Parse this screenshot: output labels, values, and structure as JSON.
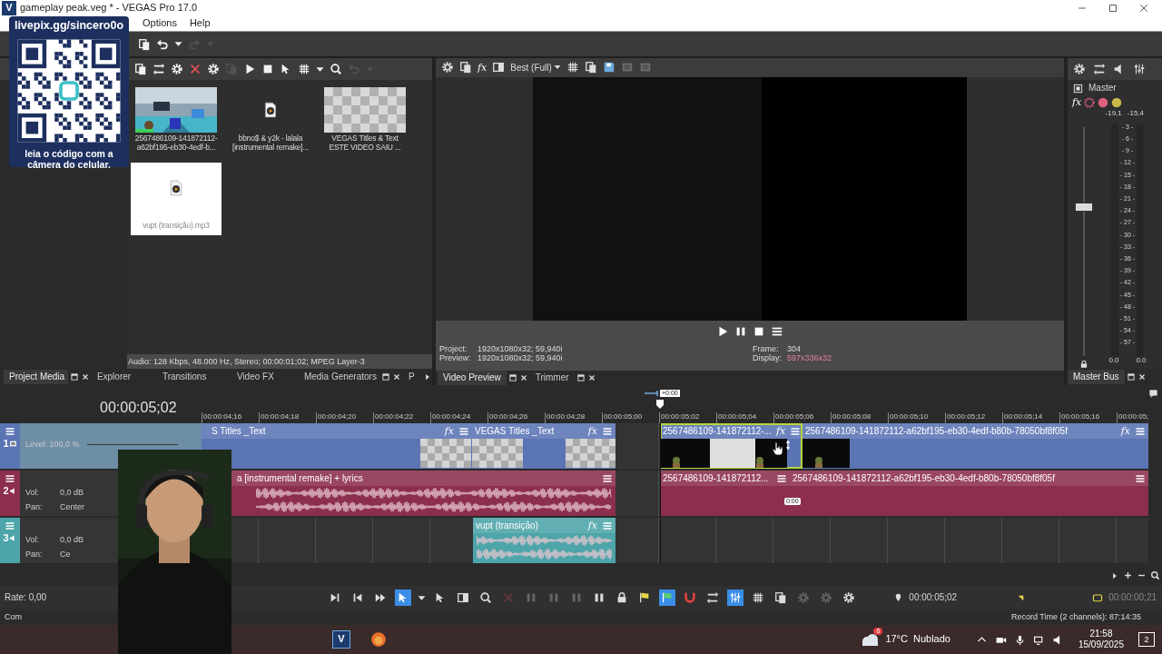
{
  "title_bar": {
    "app_letter": "V",
    "title": "gameplay peak.veg * - VEGAS Pro 17.0"
  },
  "menu": [
    "Options",
    "Help"
  ],
  "stream_overlay": {
    "url": "livepix.gg/sincero0o",
    "caption": "leia o código com a câmera do celular."
  },
  "main_toolbar": [
    {
      "disabled": false
    },
    {
      "disabled": false
    },
    {
      "disabled": false
    },
    {
      "disabled": true
    },
    {
      "disabled": true
    }
  ],
  "media_toolbar": [
    {
      "disabled": false
    },
    {
      "disabled": false
    },
    {
      "disabled": false
    },
    {
      "disabled": false
    },
    {
      "disabled": false
    },
    {
      "disabled": true
    },
    {
      "disabled": false
    },
    {
      "disabled": false
    },
    {
      "disabled": false
    },
    {
      "disabled": false
    },
    {
      "disabled": false
    },
    {
      "disabled": false
    },
    {
      "disabled": true
    },
    {
      "disabled": true
    }
  ],
  "project_media": {
    "items": [
      {
        "kind": "video",
        "lines": [
          "2567486109-141872112-",
          "a62bf195-eb30-4edf-b..."
        ],
        "selected": false
      },
      {
        "kind": "audio",
        "lines": [
          "bbno$ & y2k - lalala",
          "[instrumental remake]..."
        ],
        "selected": false
      },
      {
        "kind": "title",
        "lines": [
          "VEGAS Titles & Text",
          "ESTE VIDEO SAIU ..."
        ],
        "selected": false
      },
      {
        "kind": "audio",
        "lines": [
          "vupt (transição).mp3"
        ],
        "selected": true
      }
    ],
    "info": "Audio: 128 Kbps, 48.000 Hz, Stereo; 00:00:01;02; MPEG Layer-3"
  },
  "left_tabs": [
    {
      "label": "Project Media",
      "selected": true,
      "closable": true
    },
    {
      "label": "Explorer",
      "selected": false,
      "closable": false
    },
    {
      "label": "Transitions",
      "selected": false,
      "closable": false
    },
    {
      "label": "Video FX",
      "selected": false,
      "closable": false
    },
    {
      "label": "Media Generators",
      "selected": false,
      "closable": true
    },
    {
      "label": "P",
      "selected": false,
      "closable": false
    }
  ],
  "preview": {
    "fx": "fx",
    "quality": "Best (Full)",
    "project_label": "Project:",
    "project": "1920x1080x32; 59,940i",
    "preview_label": "Preview:",
    "preview": "1920x1080x32; 59,940i",
    "frame_label": "Frame:",
    "frame": "304",
    "display_label": "Display:",
    "display": "597x336x32"
  },
  "preview_toolbar": [
    {
      "disabled": false
    },
    {
      "disabled": false
    },
    {
      "disabled": false
    },
    {
      "disabled": false
    },
    {
      "disabled": false
    },
    {
      "disabled": false
    },
    {
      "disabled": true
    },
    {
      "disabled": true
    }
  ],
  "preview_tabs": [
    {
      "label": "Video Preview",
      "selected": true
    },
    {
      "label": "Trimmer",
      "selected": false
    }
  ],
  "master": {
    "title": "Master",
    "fx": "fx",
    "peaks": [
      "-19,1",
      "-15,4"
    ],
    "scale": [
      "- 3 -",
      "- 6 -",
      "- 9 -",
      "- 12 -",
      "- 15 -",
      "- 18 -",
      "- 21 -",
      "- 24 -",
      "- 27 -",
      "- 30 -",
      "- 33 -",
      "- 36 -",
      "- 39 -",
      "- 42 -",
      "- 45 -",
      "- 48 -",
      "- 51 -",
      "- 54 -",
      "- 57 -"
    ],
    "fader": {
      "level": 0.67
    },
    "readings": [
      "0.0",
      "0.0"
    ],
    "tab": "Master Bus"
  },
  "timeline": {
    "time": "00:00:05;02",
    "marker": "+0:00",
    "ruler": [
      "00:00:04;16",
      "00:00:04;18",
      "00:00:04;20",
      "00:00:04;22",
      "00:00:04;24",
      "00:00:04;26",
      "00:00:04;28",
      "00:00:05;00",
      "00:00:05;02",
      "00:00:05;04",
      "00:00:05;06",
      "00:00:05;08",
      "00:00:05;10",
      "00:00:05;12",
      "00:00:05;14",
      "00:00:05;16",
      "00:00:05;"
    ],
    "tracks": [
      {
        "kind": "video",
        "number": "1",
        "color": "#5b74b4",
        "selected": true,
        "level_label": "Level: 100,0 %",
        "clips": [
          {
            "name": "S Titles _Text",
            "fx": "fx",
            "kind": "title",
            "selected": false
          },
          {
            "name": "VEGAS Titles _Text",
            "fx": "fx",
            "kind": "title",
            "selected": false
          },
          {
            "name": "2567486109-141872112-...",
            "fx": "fx",
            "kind": "video",
            "selected": true
          },
          {
            "name": "2567486109-141872112-a62bf195-eb30-4edf-b80b-78050bf8f05f",
            "fx": "fx",
            "kind": "video",
            "selected": false
          }
        ]
      },
      {
        "kind": "audio",
        "number": "2",
        "color": "#8c2f4c",
        "selected": false,
        "vol_label": "Vol:",
        "vol": "0,0 dB",
        "pan_label": "Pan:",
        "pan": "Center",
        "fade_label": "0:00",
        "clips": [
          {
            "name": "a [instrumental remake] + lyrics",
            "kind": "wave",
            "selected": false
          },
          {
            "name": "2567486109-141872112...",
            "kind": "flat",
            "selected": false
          },
          {
            "name": "2567486109-141872112-a62bf195-eb30-4edf-b80b-78050bf8f05f",
            "kind": "flat",
            "selected": false
          }
        ]
      },
      {
        "kind": "audio",
        "number": "3",
        "color": "#4da4a9",
        "selected": false,
        "vol_label": "Vol:",
        "vol": "0,0 dB",
        "pan_label": "Pan:",
        "pan": "Ce",
        "clips": [
          {
            "name": "vupt (transição)",
            "fx": "fx",
            "kind": "wave",
            "selected": false
          }
        ]
      }
    ]
  },
  "tools": [
    {
      "on": false,
      "disabled": false
    },
    {
      "on": false,
      "disabled": false
    },
    {
      "on": false,
      "disabled": false
    },
    {
      "on": true,
      "disabled": false
    },
    {
      "on": false,
      "disabled": false
    },
    {
      "on": false,
      "disabled": false
    },
    {
      "on": false,
      "disabled": false
    },
    {
      "on": false,
      "disabled": false
    },
    {
      "on": false,
      "disabled": true
    },
    {
      "on": false,
      "disabled": true
    },
    {
      "on": false,
      "disabled": true
    },
    {
      "on": false,
      "disabled": true
    },
    {
      "on": false,
      "disabled": false
    },
    {
      "on": false,
      "disabled": false
    },
    {
      "on": false,
      "disabled": false
    },
    {
      "on": true,
      "disabled": false
    },
    {
      "on": false,
      "disabled": false
    },
    {
      "on": false,
      "disabled": false
    },
    {
      "on": true,
      "disabled": false
    },
    {
      "on": false,
      "disabled": false
    },
    {
      "on": false,
      "disabled": false
    },
    {
      "on": false,
      "disabled": true
    },
    {
      "on": false,
      "disabled": true
    },
    {
      "on": false,
      "disabled": false
    }
  ],
  "transport": {
    "rate": "Rate: 0,00",
    "cursor": "00:00:05;02",
    "selection": "00:00:00;21"
  },
  "status": {
    "left": "Com",
    "record": "Record Time (2 channels): 87:14:35"
  },
  "taskbar": {
    "app_letter": "V",
    "weather_badge": "6",
    "temp": "17°C",
    "weather": "Nublado",
    "time": "21:58",
    "date": "15/09/2025",
    "notifications": "2"
  }
}
